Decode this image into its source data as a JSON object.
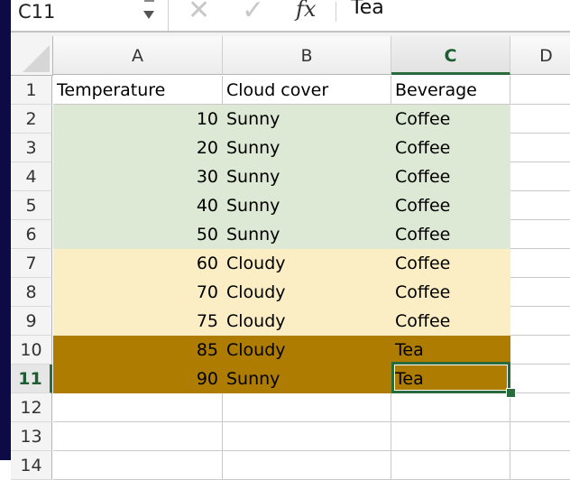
{
  "formula_bar": {
    "name_box": "C11",
    "cancel_icon": "✕",
    "enter_icon": "✓",
    "fx_label": "fx",
    "formula_value": "Tea"
  },
  "columns": [
    "A",
    "B",
    "C",
    "D"
  ],
  "selected_column": "C",
  "selected_row": 11,
  "selected_cell": "C11",
  "row_numbers": [
    "1",
    "2",
    "3",
    "4",
    "5",
    "6",
    "7",
    "8",
    "9",
    "10",
    "11",
    "12",
    "13",
    "14"
  ],
  "colors": {
    "green_fill": "#dde9d4",
    "yellow_fill": "#fbeec4",
    "brown_fill": "#ad7c00",
    "selection": "#2a6b3e"
  },
  "rows": [
    {
      "row": 1,
      "A": "Temperature",
      "B": "Cloud cover",
      "C": "Beverage",
      "fill": "none"
    },
    {
      "row": 2,
      "A": "10",
      "B": "Sunny",
      "C": "Coffee",
      "fill": "green"
    },
    {
      "row": 3,
      "A": "20",
      "B": "Sunny",
      "C": "Coffee",
      "fill": "green"
    },
    {
      "row": 4,
      "A": "30",
      "B": "Sunny",
      "C": "Coffee",
      "fill": "green"
    },
    {
      "row": 5,
      "A": "40",
      "B": "Sunny",
      "C": "Coffee",
      "fill": "green"
    },
    {
      "row": 6,
      "A": "50",
      "B": "Sunny",
      "C": "Coffee",
      "fill": "green"
    },
    {
      "row": 7,
      "A": "60",
      "B": "Cloudy",
      "C": "Coffee",
      "fill": "yellow"
    },
    {
      "row": 8,
      "A": "70",
      "B": "Cloudy",
      "C": "Coffee",
      "fill": "yellow"
    },
    {
      "row": 9,
      "A": "75",
      "B": "Cloudy",
      "C": "Coffee",
      "fill": "yellow"
    },
    {
      "row": 10,
      "A": "85",
      "B": "Cloudy",
      "C": "Tea",
      "fill": "brown"
    },
    {
      "row": 11,
      "A": "90",
      "B": "Sunny",
      "C": "Tea",
      "fill": "brown"
    },
    {
      "row": 12,
      "A": "",
      "B": "",
      "C": "",
      "fill": "none"
    },
    {
      "row": 13,
      "A": "",
      "B": "",
      "C": "",
      "fill": "none"
    }
  ]
}
